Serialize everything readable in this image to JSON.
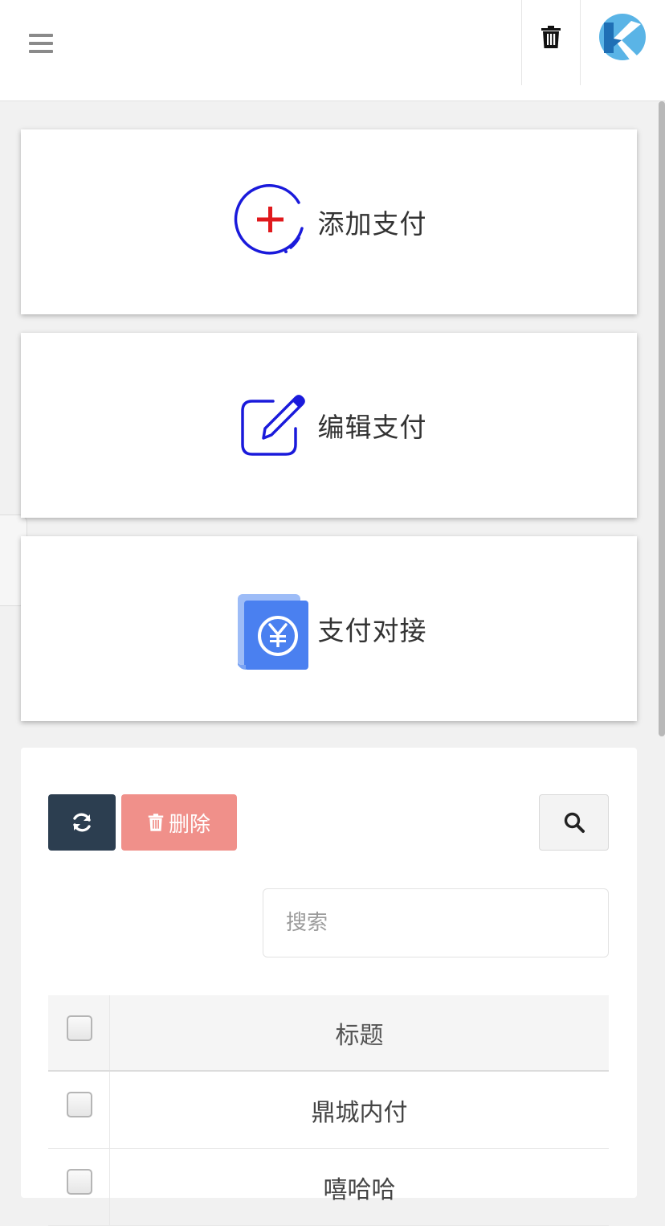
{
  "header": {
    "menu_icon": "hamburger-icon",
    "trash_icon": "trash-icon",
    "logo_icon": "k-logo-icon"
  },
  "cards": [
    {
      "label": "添加支付",
      "icon": "add-circle-icon"
    },
    {
      "label": "编辑支付",
      "icon": "edit-icon"
    },
    {
      "label": "支付对接",
      "icon": "yuan-payment-icon"
    }
  ],
  "toolbar": {
    "refresh_icon": "refresh-icon",
    "delete_label": "删除",
    "search_icon": "search-icon"
  },
  "search": {
    "placeholder": "搜索",
    "value": ""
  },
  "table": {
    "header_title": "标题",
    "rows": [
      {
        "title": "鼎城内付"
      },
      {
        "title": "嘻哈哈"
      }
    ]
  },
  "colors": {
    "primary_blue": "#1a1adb",
    "accent_red": "#e0191c",
    "refresh_btn": "#2c3e50",
    "delete_btn": "#f0908a",
    "payment_blue": "#4a80f0"
  }
}
